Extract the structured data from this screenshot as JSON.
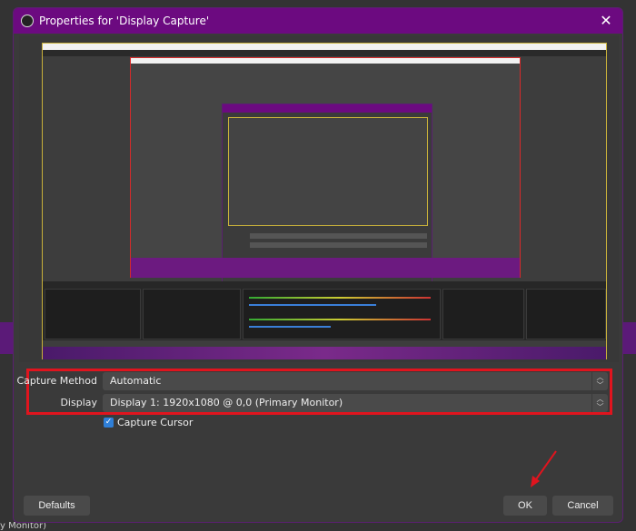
{
  "dialog": {
    "title": "Properties for 'Display Capture'",
    "close_icon": "close-icon"
  },
  "form": {
    "capture_method": {
      "label": "Capture Method",
      "value": "Automatic"
    },
    "display": {
      "label": "Display",
      "value": "Display 1: 1920x1080 @ 0,0 (Primary Monitor)"
    },
    "capture_cursor": {
      "label": "Capture Cursor",
      "checked": true
    }
  },
  "buttons": {
    "defaults": "Defaults",
    "ok": "OK",
    "cancel": "Cancel"
  },
  "background": {
    "bottom_text": "y Monitor)"
  },
  "colors": {
    "title_bar": "#6c0a80",
    "highlight": "#e0141e",
    "checkbox": "#2f7fd8"
  }
}
